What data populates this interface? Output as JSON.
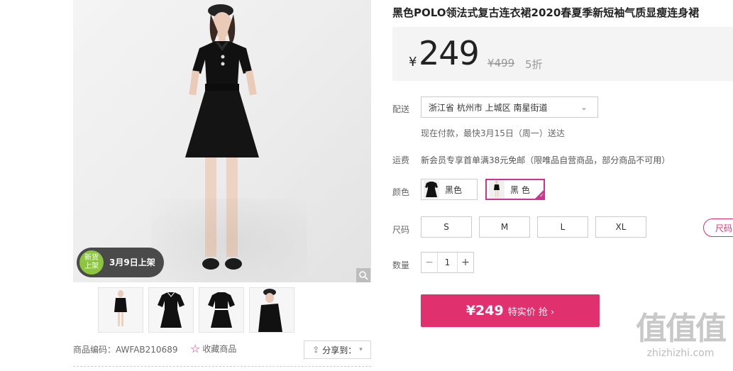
{
  "product": {
    "title": "黑色POLO领法式复古连衣裙2020春夏季新短袖气质显瘦连身裙",
    "currency": "¥",
    "price": "249",
    "original_price": "¥499",
    "discount": "5折",
    "code_label": "商品编码：AWFAB210689",
    "favorite_label": "收藏商品",
    "share_label": "分享到："
  },
  "gallery": {
    "badge_icon_text": "新货\n上架",
    "badge_text": "3月9日上架",
    "thumbs": [
      "model-front",
      "dress-flat-front",
      "dress-flat-back",
      "model-side"
    ]
  },
  "delivery": {
    "label": "配送",
    "address": "浙江省 杭州市 上城区 南星街道",
    "note": "现在付款，最快3月15日（周一）送达"
  },
  "shipping": {
    "label": "运费",
    "note": "新会员专享首单满38元免邮（限唯品自营商品，部分商品不可用）"
  },
  "colors": {
    "label": "颜色",
    "options": [
      {
        "name": "黑色",
        "selected": false
      },
      {
        "name": "黑 色",
        "selected": true
      }
    ]
  },
  "sizes": {
    "label": "尺码",
    "options": [
      "S",
      "M",
      "L",
      "XL"
    ]
  },
  "quantity": {
    "label": "数量",
    "value": "1",
    "minus": "−",
    "plus": "+"
  },
  "buy": {
    "price": "¥249",
    "label": "特实价 抢 ›"
  },
  "side_tab": {
    "label": "尺码"
  },
  "watermark": {
    "glyphs": "值值值",
    "url": "zhizhizhi.com"
  },
  "colors_theme": {
    "accent": "#e0306e",
    "selected_border": "#d0338f",
    "badge_green": "#8cc63f"
  }
}
